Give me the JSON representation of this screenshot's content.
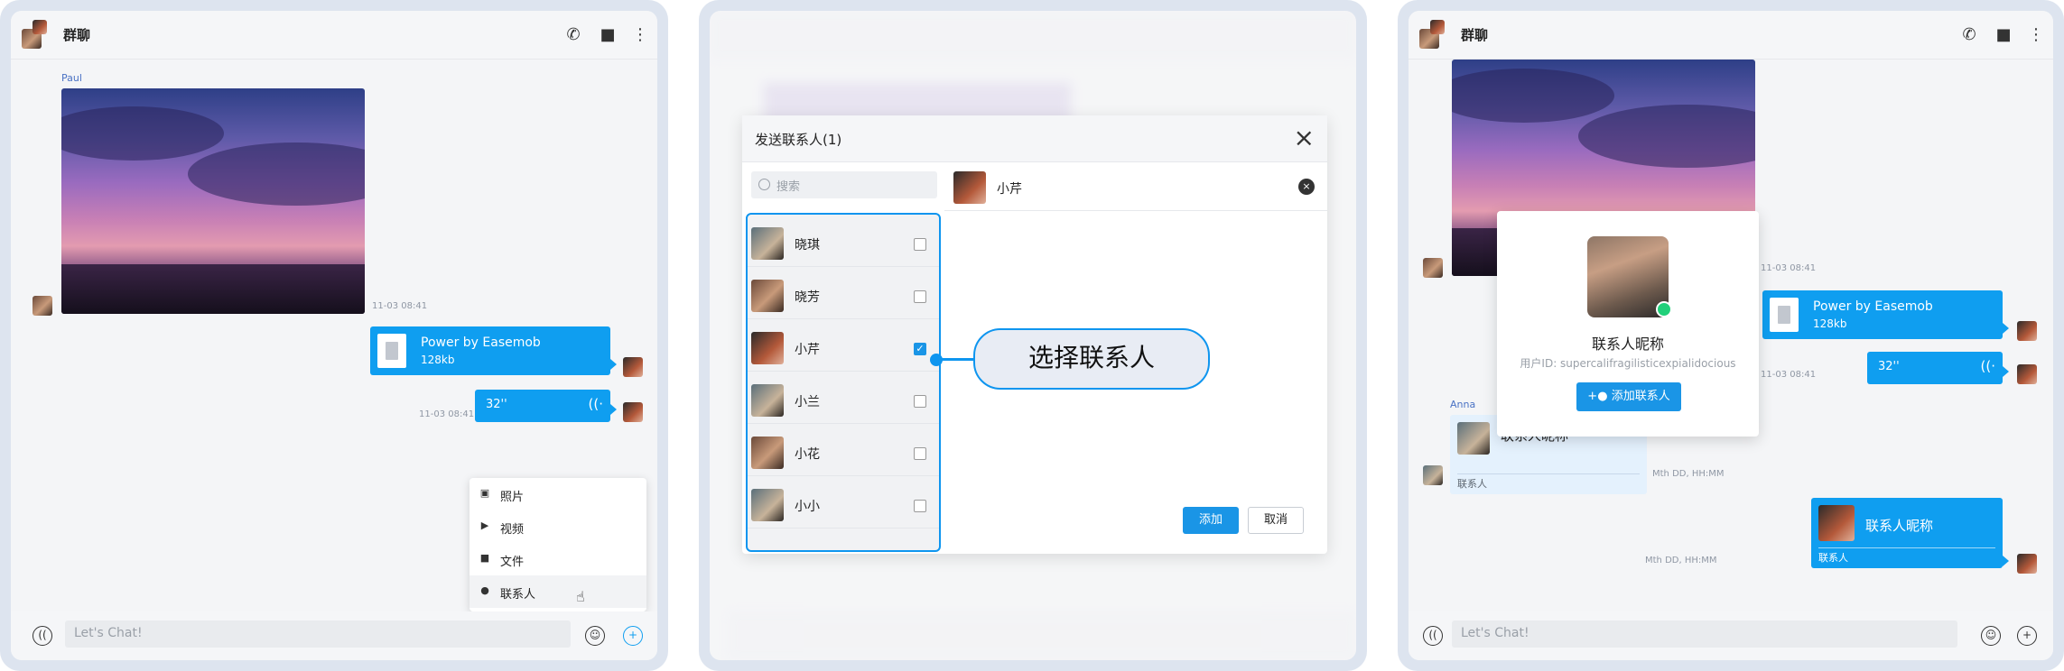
{
  "header": {
    "title": "群聊"
  },
  "panel1": {
    "sender_name": "Paul",
    "image_time": "11-03 08:41",
    "file": {
      "name": "Power by Easemob",
      "size": "128kb"
    },
    "voice": {
      "duration": "32''",
      "time": "11-03 08:41"
    },
    "menu": [
      {
        "icon": "photo-icon",
        "label": "照片"
      },
      {
        "icon": "video-icon",
        "label": "视频"
      },
      {
        "icon": "folder-icon",
        "label": "文件"
      },
      {
        "icon": "person-icon",
        "label": "联系人"
      }
    ],
    "input_placeholder": "Let's Chat!"
  },
  "panel2": {
    "dialog_title": "发送联系人(1)",
    "search_placeholder": "搜索",
    "contacts": [
      {
        "name": "晓琪",
        "checked": false
      },
      {
        "name": "晓芳",
        "checked": false
      },
      {
        "name": "小芹",
        "checked": true
      },
      {
        "name": "小兰",
        "checked": false
      },
      {
        "name": "小花",
        "checked": false
      },
      {
        "name": "小小",
        "checked": false
      }
    ],
    "selected": {
      "name": "小芹"
    },
    "add_button": "添加",
    "cancel_button": "取消",
    "callout": "选择联系人"
  },
  "panel3": {
    "card_name": "联系人昵称",
    "card_id": "用户ID: supercalifragilisticexpialidocious",
    "add_contact_button": "添加联系人",
    "image_time": "11-03 08:41",
    "file": {
      "name": "Power by Easemob",
      "size": "128kb"
    },
    "voice": {
      "duration": "32''",
      "time": "11-03 08:41"
    },
    "anna": "Anna",
    "contact_msg_name": "联系人昵称",
    "contact_msg_footer": "联系人",
    "contact_msg_time": "Mth DD, HH:MM",
    "sent_contact_name": "联系人昵称",
    "sent_contact_footer": "联系人",
    "sent_contact_time": "Mth DD, HH:MM",
    "input_placeholder": "Let's Chat!"
  },
  "colors": {
    "accent": "#0f9ef0",
    "highlight": "#0e95ef",
    "online": "#21d07a"
  }
}
